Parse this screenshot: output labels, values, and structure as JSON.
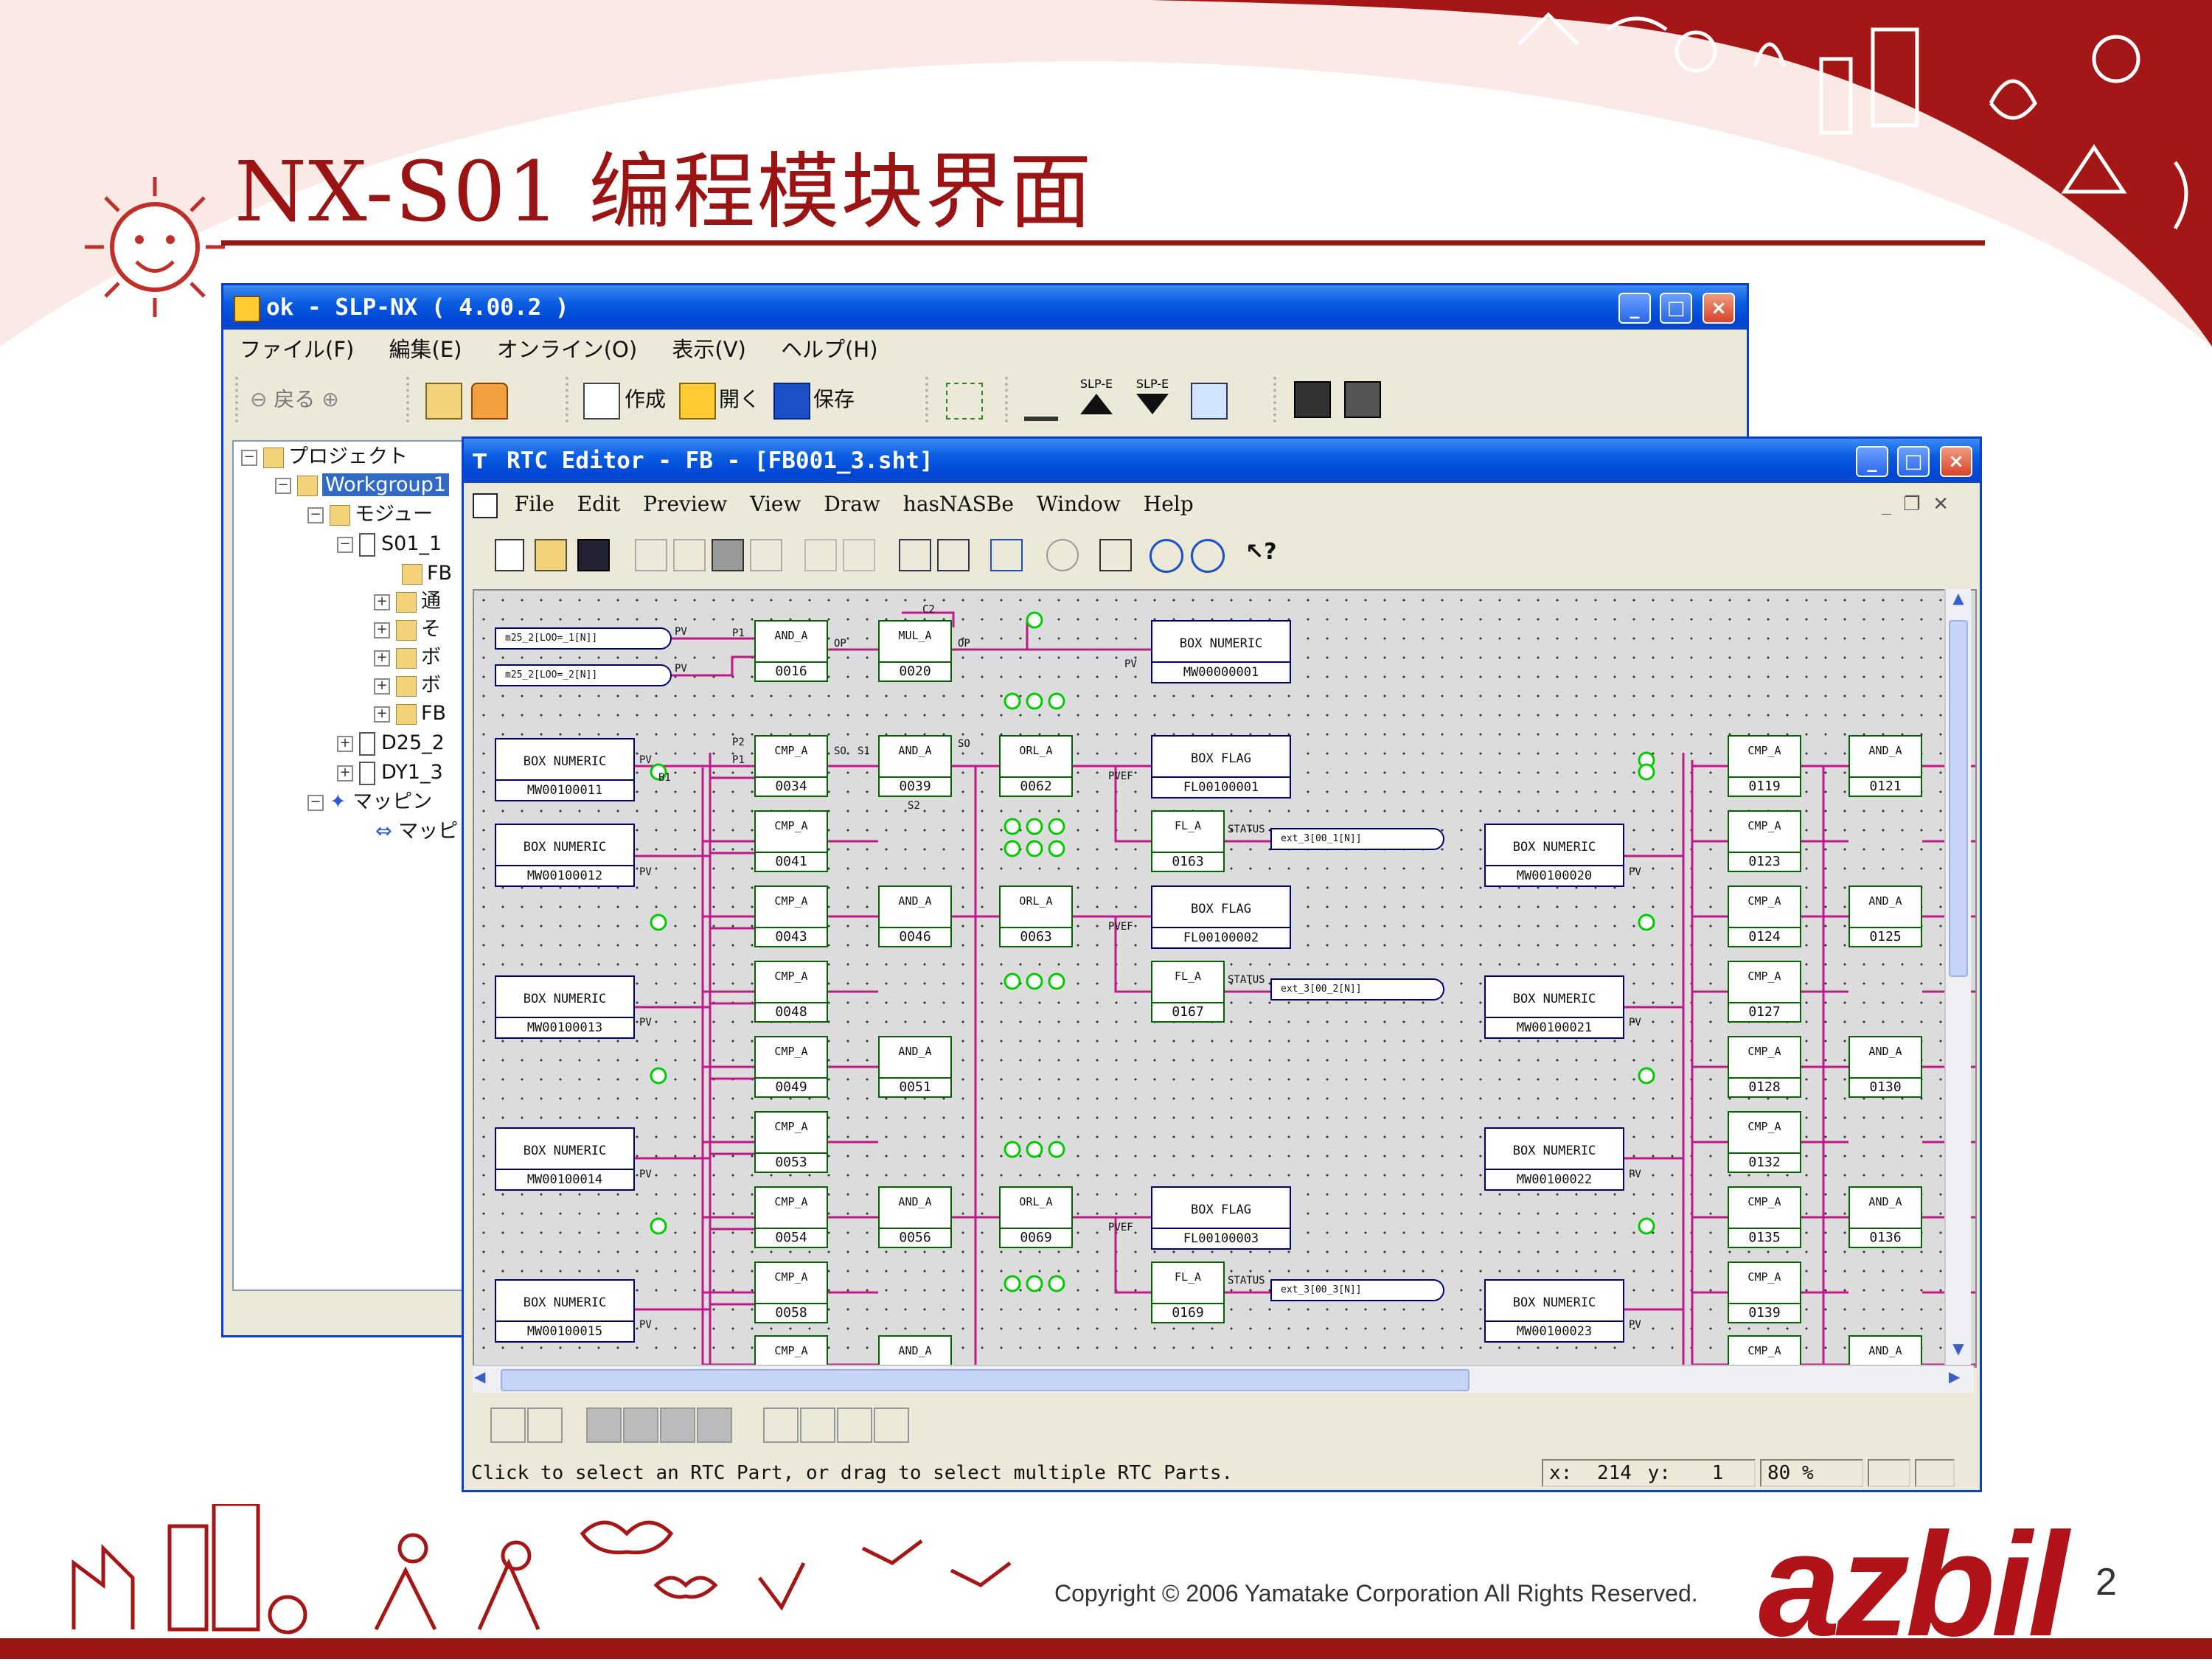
{
  "slide": {
    "title": "NX-S01 编程模块界面",
    "copyright": "Copyright © 2006 Yamatake Corporation All Rights Reserved.",
    "logo": "azbil",
    "page_number": "2",
    "accent_color": "#9a1414"
  },
  "slp_window": {
    "title": "ok - SLP-NX ( 4.00.2 )",
    "menu": [
      "ファイル(F)",
      "編集(E)",
      "オンライン(O)",
      "表示(V)",
      "ヘルプ(H)"
    ],
    "toolbar": {
      "back": "戻る",
      "create": "作成",
      "open": "開く",
      "save": "保存",
      "slp_e_up": "SLP-E",
      "slp_e_down": "SLP-E"
    },
    "tree": [
      "プロジェクト",
      "Workgroup1",
      "モジュー",
      "S01_1",
      "FB",
      "通",
      "そ",
      "ボ",
      "ボ",
      "FB",
      "D25_2",
      "DY1_3",
      "マッピン",
      "マッピ"
    ]
  },
  "rtc_window": {
    "title": "RTC Editor - FB - [FB001_3.sht]",
    "menu": [
      "File",
      "Edit",
      "Preview",
      "View",
      "Draw",
      "hasNASBe",
      "Window",
      "Help"
    ],
    "status": "Click to select an RTC Part, or drag to select multiple RTC Parts.",
    "coord_x_label": "x:",
    "coord_x": "214",
    "coord_y_label": "y:",
    "coord_y": "1",
    "zoom": "80 %"
  },
  "diagram": {
    "top_inputs": [
      "m25_2[LOO=_1[N]]",
      "m25_2[LOO=_2[N]]"
    ],
    "top_blocks": [
      {
        "name": "AND_A",
        "id": "0016"
      },
      {
        "name": "MUL_A",
        "id": "0020"
      }
    ],
    "box_numerics_left": [
      {
        "title": "BOX NUMERIC",
        "value": "MW00100011"
      },
      {
        "title": "BOX NUMERIC",
        "value": "MW00100012"
      },
      {
        "title": "BOX NUMERIC",
        "value": "MW00100013"
      },
      {
        "title": "BOX NUMERIC",
        "value": "MW00100014"
      },
      {
        "title": "BOX NUMERIC",
        "value": "MW00100015"
      }
    ],
    "box_numerics_right": [
      {
        "title": "BOX NUMERIC",
        "value": "MW00100020"
      },
      {
        "title": "BOX NUMERIC",
        "value": "MW00100021"
      },
      {
        "title": "BOX NUMERIC",
        "value": "MW00100022"
      },
      {
        "title": "BOX NUMERIC",
        "value": "MW00100023"
      }
    ],
    "box_top": {
      "title": "BOX NUMERIC",
      "value": "MW00000001"
    },
    "box_flags": [
      {
        "title": "BOX FLAG",
        "value": "FL00100001"
      },
      {
        "title": "BOX FLAG",
        "value": "FL00100002"
      },
      {
        "title": "BOX FLAG",
        "value": "FL00100003"
      }
    ],
    "cmp_left": [
      {
        "name": "CMP_A",
        "id": "0034"
      },
      {
        "name": "CMP_A",
        "id": "0041"
      },
      {
        "name": "CMP_A",
        "id": "0043"
      },
      {
        "name": "CMP_A",
        "id": "0048"
      },
      {
        "name": "CMP_A",
        "id": "0049"
      },
      {
        "name": "CMP_A",
        "id": "0053"
      },
      {
        "name": "CMP_A",
        "id": "0054"
      },
      {
        "name": "CMP_A",
        "id": "0058"
      },
      {
        "name": "CMP_A",
        "id": ""
      }
    ],
    "and_left": [
      {
        "name": "AND_A",
        "id": "0039"
      },
      {
        "name": "AND_A",
        "id": "0046"
      },
      {
        "name": "AND_A",
        "id": "0051"
      },
      {
        "name": "AND_A",
        "id": "0056"
      },
      {
        "name": "AND_A",
        "id": ""
      }
    ],
    "orl_blocks": [
      {
        "name": "ORL_A",
        "id": "0062"
      },
      {
        "name": "ORL_A",
        "id": "0063"
      },
      {
        "name": "ORL_A",
        "id": "0069"
      }
    ],
    "fl_blocks": [
      {
        "name": "FL_A",
        "id": "0163"
      },
      {
        "name": "FL_A",
        "id": "0167"
      },
      {
        "name": "FL_A",
        "id": "0169"
      }
    ],
    "fl_outputs": [
      "ext_3[00_1[N]]",
      "ext_3[00_2[N]]",
      "ext_3[00_3[N]]"
    ],
    "cmp_right": [
      {
        "name": "CMP_A",
        "id": "0119"
      },
      {
        "name": "CMP_A",
        "id": "0123"
      },
      {
        "name": "CMP_A",
        "id": "0124"
      },
      {
        "name": "CMP_A",
        "id": "0127"
      },
      {
        "name": "CMP_A",
        "id": "0128"
      },
      {
        "name": "CMP_A",
        "id": "0132"
      },
      {
        "name": "CMP_A",
        "id": "0135"
      },
      {
        "name": "CMP_A",
        "id": "0139"
      },
      {
        "name": "CMP_A",
        "id": ""
      }
    ],
    "and_right": [
      {
        "name": "AND_A",
        "id": "0121"
      },
      {
        "name": "AND_A",
        "id": "0125"
      },
      {
        "name": "AND_A",
        "id": "0130"
      },
      {
        "name": "AND_A",
        "id": "0136"
      },
      {
        "name": "AND_A",
        "id": ""
      }
    ],
    "port_labels": {
      "pv": "PV",
      "p1": "P1",
      "p2": "P2",
      "so": "SO",
      "s1": "S1",
      "s2": "S2",
      "op": "OP",
      "b1": "B1",
      "c2": "C2",
      "pvef": "PVEF",
      "status": "STATUS"
    }
  }
}
